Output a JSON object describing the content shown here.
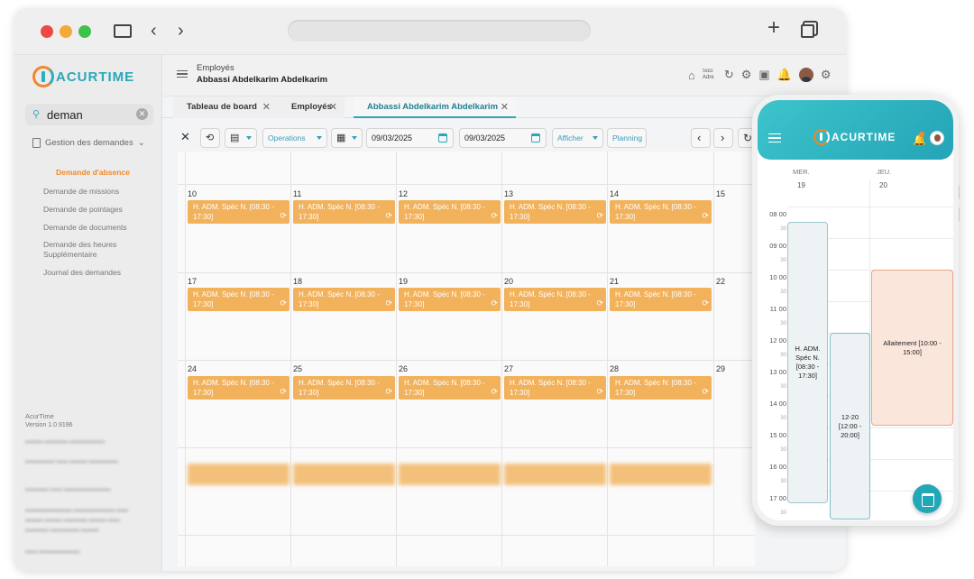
{
  "app": {
    "logo": "ACURTIME",
    "version_label": "AcurTime",
    "version": "Version 1.0.9196"
  },
  "search": {
    "value": "deman"
  },
  "sidebar": {
    "group": "Gestion des demandes",
    "items": [
      {
        "label": "Demande d'absence",
        "active": true
      },
      {
        "label": "Demande de missions"
      },
      {
        "label": "Demande de pointages"
      },
      {
        "label": "Demande de documents"
      },
      {
        "label": "Demande des heures Supplémentaire"
      },
      {
        "label": "Journal des demandes"
      }
    ]
  },
  "header": {
    "section": "Employés",
    "employee": "Abbassi Abdelkarim Abdelkarim",
    "soc": "Soci",
    "adr": "Adre"
  },
  "tabs": [
    {
      "label": "Tableau de board"
    },
    {
      "label": "Employés"
    },
    {
      "label": "Abbassi Abdelkarim Abdelkarim",
      "active": true
    }
  ],
  "toolbar": {
    "operations": "Operations",
    "date_from": "09/03/2025",
    "date_to": "09/03/2025",
    "afficher": "Afficher",
    "planning": "Planning"
  },
  "calendar": {
    "weeks": [
      {
        "days": [
          "10",
          "11",
          "12",
          "13",
          "14",
          "15"
        ]
      },
      {
        "days": [
          "17",
          "18",
          "19",
          "20",
          "21",
          "22"
        ]
      },
      {
        "days": [
          "24",
          "25",
          "26",
          "27",
          "28",
          "29"
        ]
      }
    ],
    "event_label": "H. ADM. Spéc N. [08:30 - 17:30]"
  },
  "mobile": {
    "days": [
      {
        "name": "MER.",
        "num": "19"
      },
      {
        "name": "JEU.",
        "num": "20"
      }
    ],
    "hours": [
      "08 00",
      "09 00",
      "10 00",
      "11 00",
      "12 00",
      "13 00",
      "14 00",
      "15 00",
      "16 00",
      "17 00"
    ],
    "minute_mark": "30",
    "events": [
      {
        "label": "H. ADM. Spéc N. [08:30 - 17:30]",
        "color": "#edf3f5"
      },
      {
        "label": "12-20 [12:00 - 20:00]",
        "color": "#edf3f5"
      },
      {
        "label": "Allaitement [10:00 - 15:00]",
        "color": "#fbe6dc"
      }
    ]
  },
  "colors": {
    "accent": "#2aa7b8",
    "orange": "#f08a2a",
    "event": "#f2b25c"
  }
}
